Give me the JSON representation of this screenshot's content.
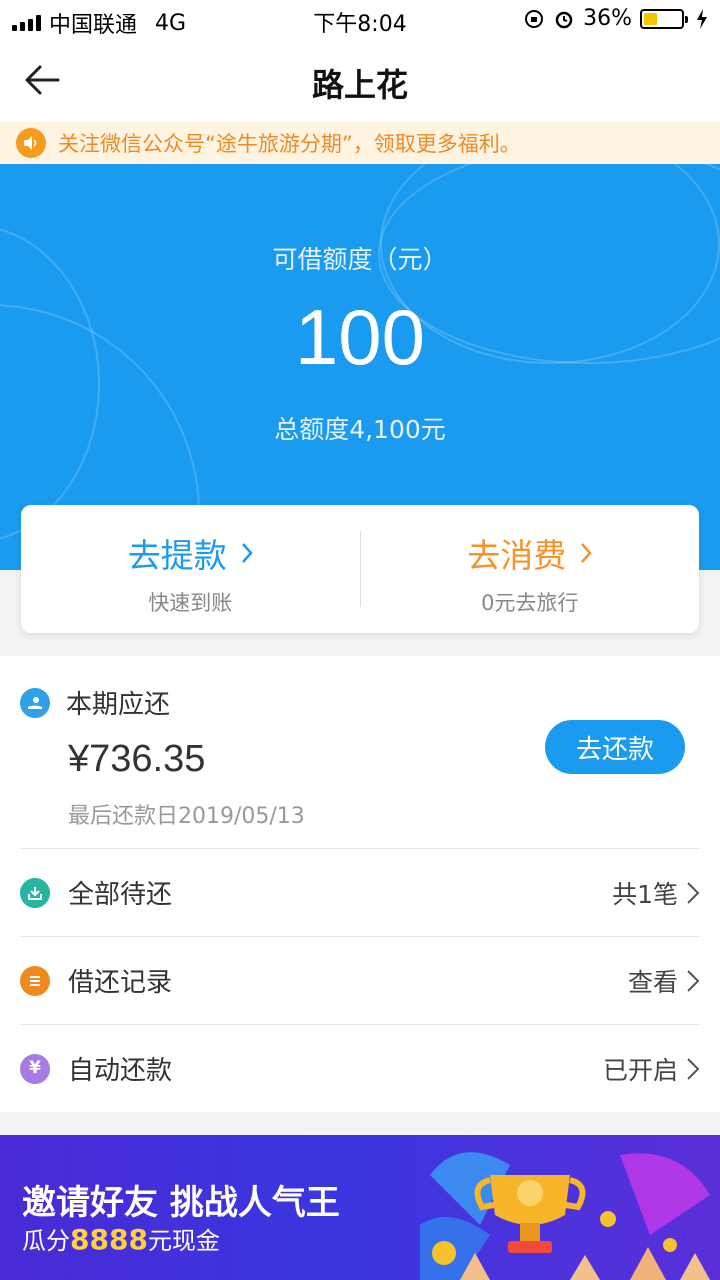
{
  "status": {
    "carrier": "中国联通",
    "network": "4G",
    "time": "下午8:04",
    "battery": "36%"
  },
  "nav": {
    "title": "路上花"
  },
  "notice": {
    "text": "关注微信公众号“途牛旅游分期”，领取更多福利。"
  },
  "hero": {
    "label": "可借额度（元）",
    "amount": "100",
    "total": "总额度4,100元"
  },
  "actions": [
    {
      "title": "去提款",
      "sub": "快速到账",
      "color": "#1a9bf0"
    },
    {
      "title": "去消费",
      "sub": "0元去旅行",
      "color": "#f5922a"
    }
  ],
  "due": {
    "heading": "本期应还",
    "amount": "¥736.35",
    "date": "最后还款日2019/05/13",
    "button": "去还款"
  },
  "rows": [
    {
      "label": "全部待还",
      "value": "共1笔",
      "icon": "download-icon",
      "color": "#26b5a0"
    },
    {
      "label": "借还记录",
      "value": "查看",
      "icon": "list-icon",
      "color": "#f0891e"
    },
    {
      "label": "自动还款",
      "value": "已开启",
      "icon": "yen-icon",
      "color": "#a77be6"
    }
  ],
  "banner": {
    "title": "邀请好友 挑战人气王",
    "sub_prefix": "瓜分",
    "sub_highlight": "8888",
    "sub_suffix": "元现金"
  },
  "colors": {
    "primary": "#1a9bf0",
    "accent_orange": "#f5922a",
    "notice_text": "#f08a24"
  }
}
